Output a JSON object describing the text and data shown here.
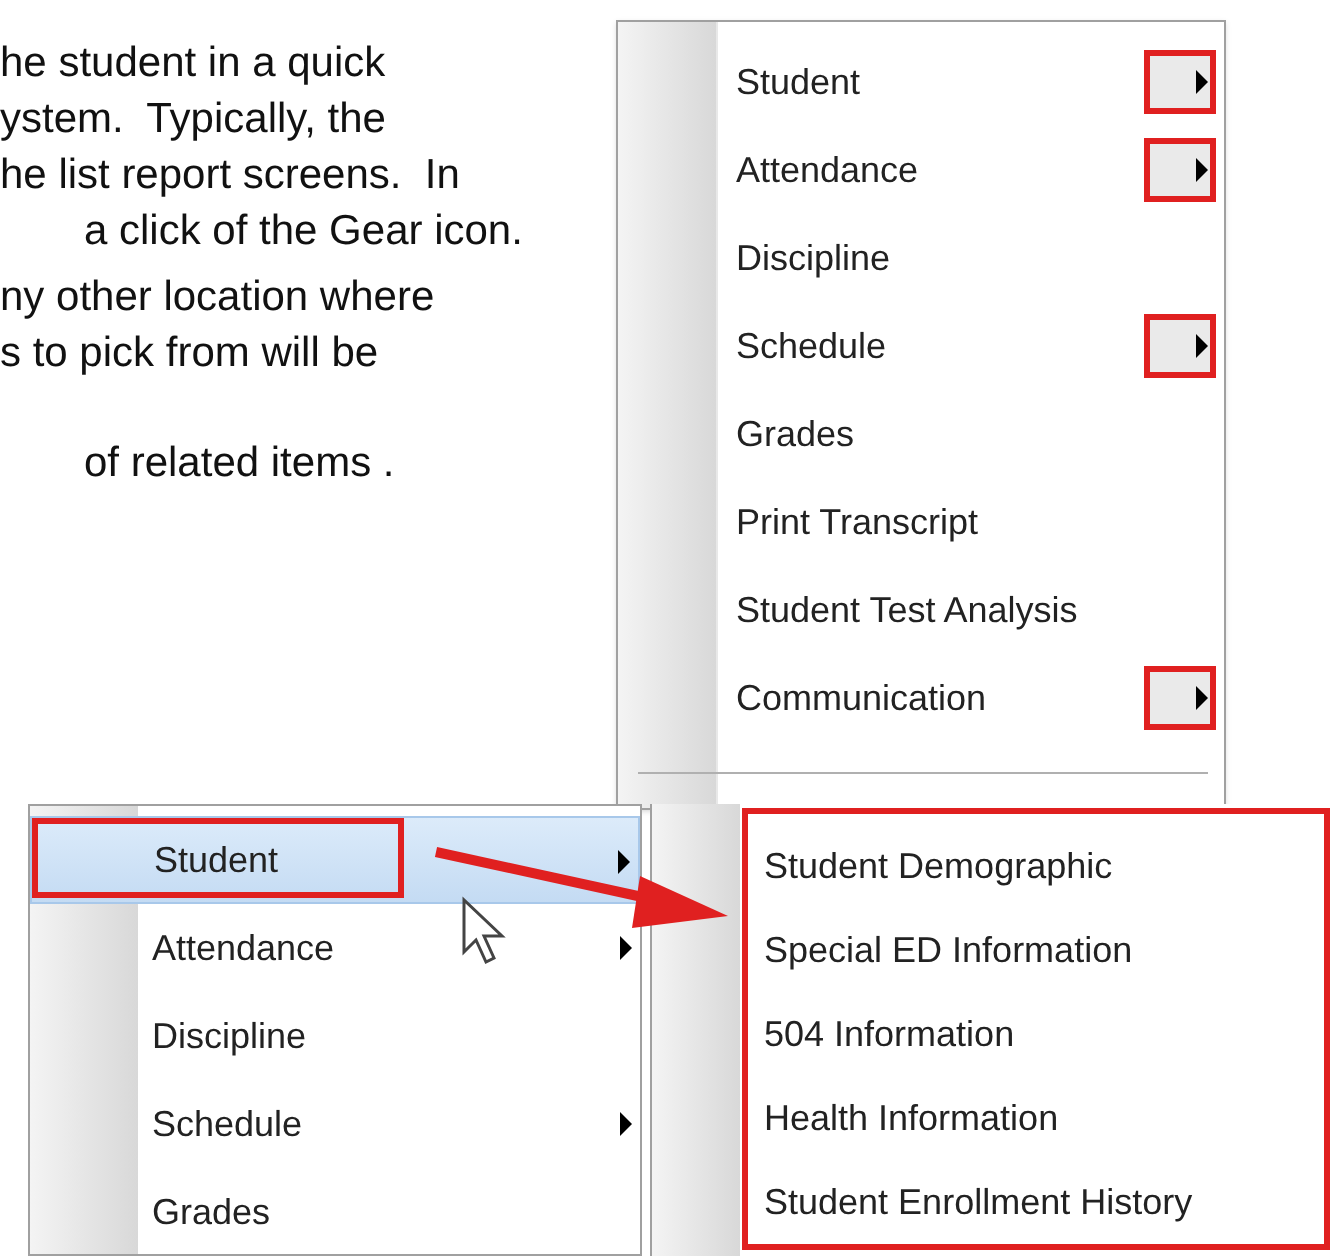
{
  "document": {
    "paragraphs": [
      {
        "lines": [
          {
            "text": "he student in a quick",
            "kind": "cut"
          },
          {
            "text": "ystem.  Typically, the",
            "kind": "cut"
          },
          {
            "text": "he list report screens.  In",
            "kind": "cut"
          },
          {
            "text": "a click of the Gear icon.",
            "kind": "indented"
          }
        ]
      },
      {
        "lines": [
          {
            "text": "ny other location where",
            "kind": "cut"
          },
          {
            "text": "s to pick from will be",
            "kind": "cut"
          }
        ]
      },
      {
        "lines": [
          {
            "text": "of related items .",
            "kind": "indented"
          }
        ]
      }
    ]
  },
  "gear_menu": {
    "items": [
      {
        "label": "Student",
        "submenu": true
      },
      {
        "label": "Attendance",
        "submenu": true
      },
      {
        "label": "Discipline",
        "submenu": false
      },
      {
        "label": "Schedule",
        "submenu": true
      },
      {
        "label": "Grades",
        "submenu": false
      },
      {
        "label": "Print Transcript",
        "submenu": false
      },
      {
        "label": "Student Test Analysis",
        "submenu": false
      },
      {
        "label": "Communication",
        "submenu": true
      }
    ]
  },
  "context_menu": {
    "items": [
      {
        "label": "Student",
        "submenu": true,
        "selected": true
      },
      {
        "label": "Attendance",
        "submenu": true,
        "selected": false
      },
      {
        "label": "Discipline",
        "submenu": false,
        "selected": false
      },
      {
        "label": "Schedule",
        "submenu": true,
        "selected": false
      },
      {
        "label": "Grades",
        "submenu": false,
        "selected": false
      }
    ]
  },
  "student_submenu": {
    "items": [
      {
        "label": "Student Demographic"
      },
      {
        "label": "Special ED Information"
      },
      {
        "label": "504 Information"
      },
      {
        "label": "Health Information"
      },
      {
        "label": "Student Enrollment History"
      }
    ]
  }
}
